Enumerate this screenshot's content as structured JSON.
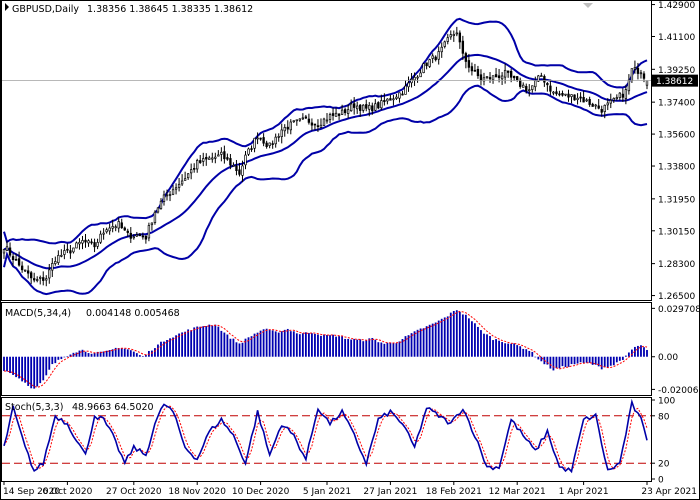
{
  "chart_data": [
    {
      "type": "candlestick",
      "title": "GBPUSD,Daily",
      "ohlc_header": [
        "1.38356",
        "1.38645",
        "1.38335",
        "1.38612"
      ],
      "current_price_label": "1.38612",
      "current_price": 1.38612,
      "ylim": [
        1.2625,
        1.431
      ],
      "yticks": [
        "1.42900",
        "1.41100",
        "1.39250",
        "1.37400",
        "1.35600",
        "1.33800",
        "1.31950",
        "1.30150",
        "1.28300",
        "1.26500"
      ],
      "x_labels": [
        "14 Sep 2020",
        "6 Oct 2020",
        "27 Oct 2020",
        "18 Nov 2020",
        "10 Dec 2020",
        "5 Jan 2021",
        "27 Jan 2021",
        "18 Feb 2021",
        "12 Mar 2021",
        "1 Apr 2021",
        "23 Apr 2021"
      ],
      "close_anchors": [
        [
          0,
          1.293
        ],
        [
          5,
          1.282
        ],
        [
          10,
          1.273
        ],
        [
          14,
          1.275
        ],
        [
          17,
          1.286
        ],
        [
          22,
          1.2905
        ],
        [
          26,
          1.2955
        ],
        [
          30,
          1.293
        ],
        [
          34,
          1.3035
        ],
        [
          38,
          1.305
        ],
        [
          41,
          1.299
        ],
        [
          44,
          1.299
        ],
        [
          47,
          1.298
        ],
        [
          50,
          1.3125
        ],
        [
          53,
          1.32
        ],
        [
          56,
          1.325
        ],
        [
          60,
          1.3315
        ],
        [
          64,
          1.3395
        ],
        [
          68,
          1.342
        ],
        [
          72,
          1.344
        ],
        [
          76,
          1.338
        ],
        [
          78,
          1.334
        ],
        [
          80,
          1.343
        ],
        [
          84,
          1.3555
        ],
        [
          88,
          1.349
        ],
        [
          92,
          1.3585
        ],
        [
          96,
          1.362
        ],
        [
          100,
          1.364
        ],
        [
          104,
          1.362
        ],
        [
          108,
          1.366
        ],
        [
          112,
          1.368
        ],
        [
          116,
          1.3725
        ],
        [
          120,
          1.37
        ],
        [
          124,
          1.372
        ],
        [
          128,
          1.376
        ],
        [
          132,
          1.38
        ],
        [
          136,
          1.388
        ],
        [
          140,
          1.396
        ],
        [
          144,
          1.401
        ],
        [
          148,
          1.411
        ],
        [
          150,
          1.414
        ],
        [
          152,
          1.4
        ],
        [
          155,
          1.392
        ],
        [
          158,
          1.387
        ],
        [
          162,
          1.388
        ],
        [
          166,
          1.39
        ],
        [
          170,
          1.385
        ],
        [
          174,
          1.381
        ],
        [
          178,
          1.389
        ],
        [
          182,
          1.379
        ],
        [
          186,
          1.3775
        ],
        [
          190,
          1.377
        ],
        [
          194,
          1.3735
        ],
        [
          198,
          1.37
        ],
        [
          202,
          1.3745
        ],
        [
          206,
          1.38
        ],
        [
          208,
          1.392
        ],
        [
          211,
          1.392
        ],
        [
          213,
          1.3862
        ]
      ],
      "bollinger_color": "#0000a8",
      "candle_color": "#000000"
    },
    {
      "type": "bar",
      "title": "MACD(5,34,4)",
      "values_header": [
        "0.004148",
        "0.005468"
      ],
      "ylim": [
        -0.0235,
        0.033
      ],
      "yticks": [
        "0.029708",
        "0.00",
        "-0.020061"
      ],
      "histogram_anchors": [
        [
          0,
          -0.008
        ],
        [
          4,
          -0.012
        ],
        [
          7,
          -0.016
        ],
        [
          10,
          -0.02
        ],
        [
          13,
          -0.015
        ],
        [
          16,
          -0.005
        ],
        [
          20,
          0.0
        ],
        [
          23,
          0.003
        ],
        [
          26,
          0.004
        ],
        [
          30,
          0.002
        ],
        [
          34,
          0.003
        ],
        [
          38,
          0.006
        ],
        [
          42,
          0.004
        ],
        [
          46,
          0.0
        ],
        [
          50,
          0.006
        ],
        [
          54,
          0.011
        ],
        [
          58,
          0.014
        ],
        [
          62,
          0.017
        ],
        [
          66,
          0.019
        ],
        [
          70,
          0.02
        ],
        [
          74,
          0.013
        ],
        [
          78,
          0.008
        ],
        [
          82,
          0.013
        ],
        [
          86,
          0.017
        ],
        [
          90,
          0.015
        ],
        [
          94,
          0.017
        ],
        [
          98,
          0.014
        ],
        [
          102,
          0.015
        ],
        [
          106,
          0.013
        ],
        [
          110,
          0.013
        ],
        [
          114,
          0.011
        ],
        [
          118,
          0.01
        ],
        [
          122,
          0.011
        ],
        [
          126,
          0.008
        ],
        [
          130,
          0.009
        ],
        [
          134,
          0.013
        ],
        [
          138,
          0.017
        ],
        [
          142,
          0.02
        ],
        [
          146,
          0.024
        ],
        [
          150,
          0.029
        ],
        [
          154,
          0.024
        ],
        [
          158,
          0.016
        ],
        [
          162,
          0.011
        ],
        [
          166,
          0.009
        ],
        [
          170,
          0.007
        ],
        [
          174,
          0.004
        ],
        [
          178,
          -0.003
        ],
        [
          182,
          -0.008
        ],
        [
          186,
          -0.006
        ],
        [
          190,
          -0.004
        ],
        [
          194,
          -0.004
        ],
        [
          198,
          -0.007
        ],
        [
          202,
          -0.005
        ],
        [
          206,
          0.0
        ],
        [
          209,
          0.006
        ],
        [
          211,
          0.007
        ],
        [
          213,
          0.0042
        ]
      ],
      "signal_color": "#ff0000",
      "bar_color": "#0000b0"
    },
    {
      "type": "line",
      "title": "Stoch(5,3,3)",
      "values_header": [
        "48.9663",
        "64.5020"
      ],
      "ylim": [
        0,
        100
      ],
      "yticks": [
        "100",
        "80",
        "20",
        "0"
      ],
      "levels": [
        80,
        20
      ],
      "main_anchors": [
        [
          0,
          40
        ],
        [
          3,
          90
        ],
        [
          7,
          40
        ],
        [
          10,
          10
        ],
        [
          13,
          20
        ],
        [
          17,
          80
        ],
        [
          21,
          70
        ],
        [
          24,
          50
        ],
        [
          27,
          30
        ],
        [
          30,
          80
        ],
        [
          33,
          75
        ],
        [
          36,
          55
        ],
        [
          40,
          20
        ],
        [
          43,
          40
        ],
        [
          47,
          30
        ],
        [
          50,
          70
        ],
        [
          53,
          95
        ],
        [
          56,
          85
        ],
        [
          60,
          40
        ],
        [
          64,
          25
        ],
        [
          68,
          60
        ],
        [
          72,
          75
        ],
        [
          76,
          55
        ],
        [
          80,
          20
        ],
        [
          84,
          85
        ],
        [
          88,
          30
        ],
        [
          92,
          70
        ],
        [
          96,
          55
        ],
        [
          100,
          25
        ],
        [
          104,
          90
        ],
        [
          108,
          70
        ],
        [
          112,
          85
        ],
        [
          116,
          55
        ],
        [
          120,
          20
        ],
        [
          124,
          75
        ],
        [
          128,
          85
        ],
        [
          132,
          70
        ],
        [
          136,
          40
        ],
        [
          140,
          90
        ],
        [
          144,
          80
        ],
        [
          148,
          70
        ],
        [
          152,
          90
        ],
        [
          156,
          55
        ],
        [
          160,
          15
        ],
        [
          164,
          15
        ],
        [
          168,
          75
        ],
        [
          172,
          55
        ],
        [
          176,
          35
        ],
        [
          180,
          60
        ],
        [
          184,
          15
        ],
        [
          188,
          10
        ],
        [
          192,
          75
        ],
        [
          196,
          80
        ],
        [
          200,
          10
        ],
        [
          204,
          20
        ],
        [
          208,
          95
        ],
        [
          211,
          75
        ],
        [
          213,
          49
        ]
      ],
      "main_color": "#0000a8",
      "signal_color": "#ff0000",
      "level_color": "#c00000"
    }
  ]
}
